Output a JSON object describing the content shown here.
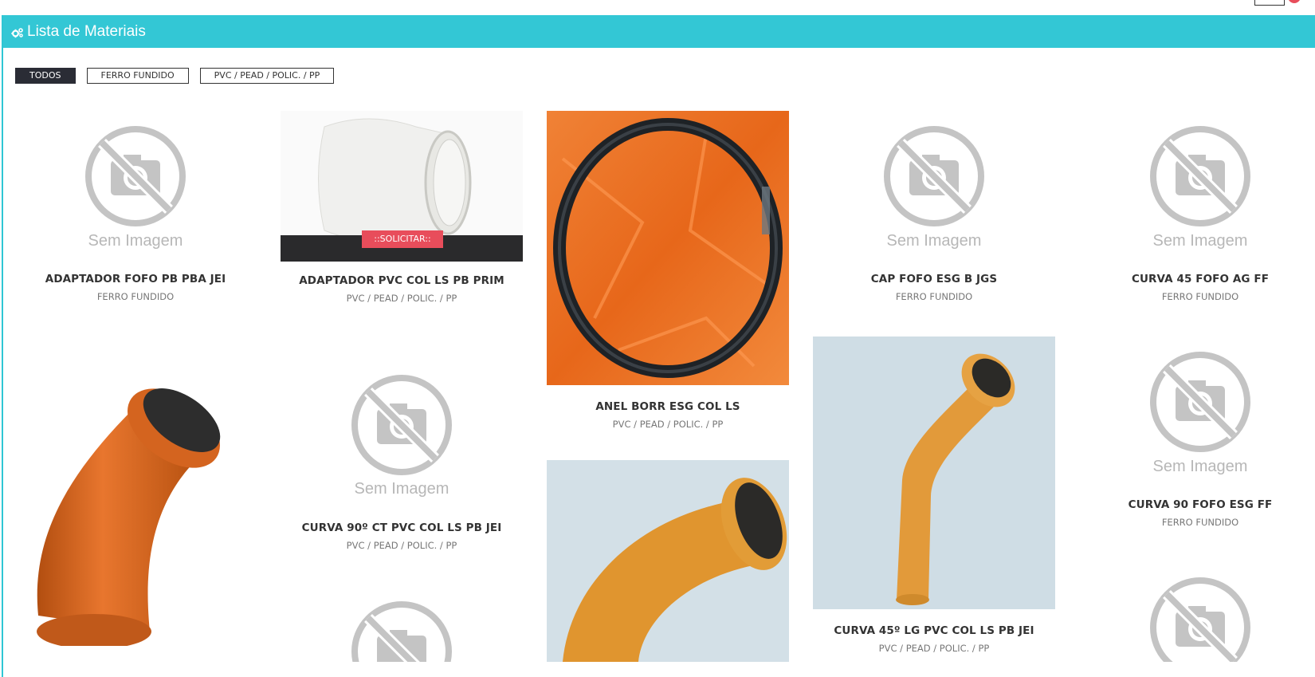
{
  "panel": {
    "title": "Lista de Materiais"
  },
  "filters": [
    {
      "label": "TODOS",
      "active": true
    },
    {
      "label": "FERRO FUNDIDO",
      "active": false
    },
    {
      "label": "PVC / PEAD / POLIC. / PP",
      "active": false
    }
  ],
  "no_image_label": "Sem Imagem",
  "solicitar_label": "::SOLICITAR::",
  "products": [
    {
      "name": "ADAPTADOR FOFO PB PBA JEI",
      "category": "FERRO FUNDIDO",
      "image": "no-image"
    },
    {
      "name": "ADAPTADOR PVC COL LS PB PRIM",
      "category": "PVC / PEAD / POLIC. / PP",
      "image": "white-pvc-adapter"
    },
    {
      "name": "ANEL BORR ESG COL LS",
      "category": "PVC / PEAD / POLIC. / PP",
      "image": "rubber-ring"
    },
    {
      "name": "CAP FOFO ESG B JGS",
      "category": "FERRO FUNDIDO",
      "image": "no-image"
    },
    {
      "name": "CURVA 45 FOFO AG FF",
      "category": "FERRO FUNDIDO",
      "image": "no-image"
    },
    {
      "name": "",
      "category": "",
      "image": "orange-pipe-elbow-45"
    },
    {
      "name": "CURVA 90º CT PVC COL LS PB JEI",
      "category": "PVC / PEAD / POLIC. / PP",
      "image": "no-image"
    },
    {
      "name": "",
      "category": "",
      "image": "orange-pipe-bend-90"
    },
    {
      "name": "CURVA 45º LG PVC COL LS PB JEI",
      "category": "PVC / PEAD / POLIC. / PP",
      "image": "orange-pipe-long-bend-45"
    },
    {
      "name": "CURVA 90 FOFO ESG FF",
      "category": "FERRO FUNDIDO",
      "image": "no-image"
    },
    {
      "name": "",
      "category": "",
      "image": "no-image"
    },
    {
      "name": "",
      "category": "",
      "image": "no-image"
    }
  ]
}
